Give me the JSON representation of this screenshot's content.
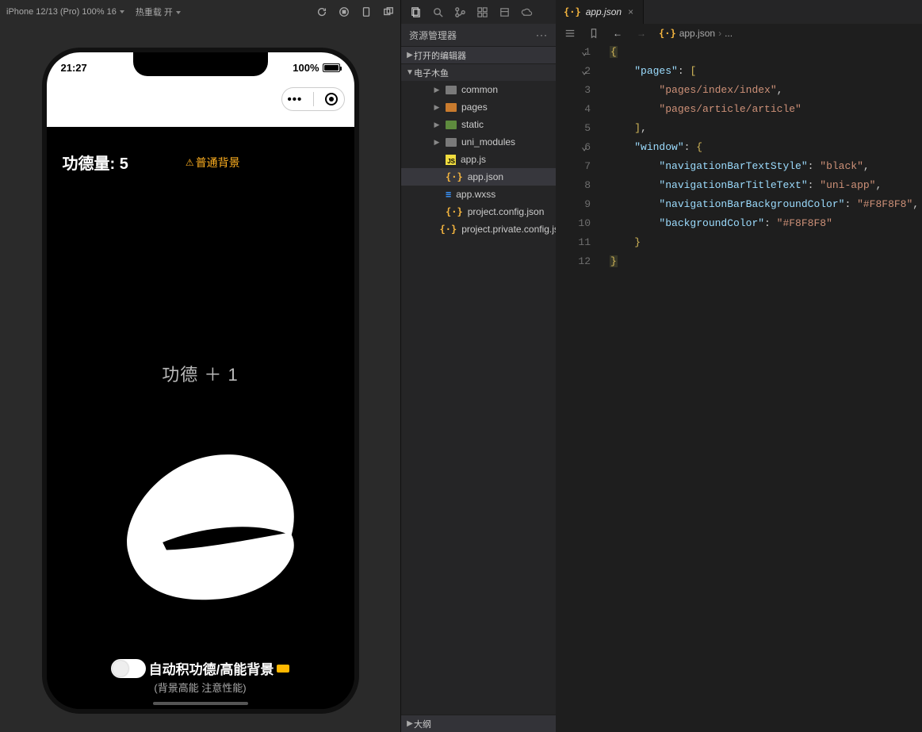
{
  "simulator": {
    "device_label": "iPhone 12/13 (Pro) 100% 16",
    "hot_reload_label": "热重载 开",
    "statusbar": {
      "time": "21:27",
      "battery_text": "100%"
    },
    "app": {
      "merit_label": "功德量: 5",
      "bg_mode_label": "普通背景",
      "float_text": "功德 ＋ 1",
      "auto_label": "自动积功德/高能背景",
      "auto_note": "(背景高能 注意性能)"
    }
  },
  "activity_icons": [
    "files-icon",
    "search-icon",
    "source-control-icon",
    "ext1-icon",
    "run-icon",
    "ext2-icon"
  ],
  "explorer": {
    "title": "资源管理器",
    "more_label": "···",
    "open_editors_label": "打开的编辑器",
    "project_label": "电子木鱼",
    "outline_label": "大纲",
    "tree": [
      {
        "type": "folder",
        "label": "common",
        "color": "gray"
      },
      {
        "type": "folder",
        "label": "pages",
        "color": "orange"
      },
      {
        "type": "folder",
        "label": "static",
        "color": "green"
      },
      {
        "type": "folder",
        "label": "uni_modules",
        "color": "gray"
      },
      {
        "type": "file",
        "label": "app.js",
        "icon": "js"
      },
      {
        "type": "file",
        "label": "app.json",
        "icon": "json",
        "selected": true
      },
      {
        "type": "file",
        "label": "app.wxss",
        "icon": "wxss"
      },
      {
        "type": "file",
        "label": "project.config.json",
        "icon": "json"
      },
      {
        "type": "file",
        "label": "project.private.config.js...",
        "icon": "json"
      }
    ]
  },
  "editor": {
    "tab_label": "app.json",
    "breadcrumb_file": "app.json",
    "breadcrumb_tail": "...",
    "code_lines": [
      {
        "n": 1,
        "ind": 0,
        "tokens": [
          {
            "t": "{",
            "c": "brace",
            "hl": true
          }
        ]
      },
      {
        "n": 2,
        "ind": 1,
        "tokens": [
          {
            "t": "\"pages\"",
            "c": "key"
          },
          {
            "t": ": ",
            "c": "punc"
          },
          {
            "t": "[",
            "c": "brace"
          }
        ]
      },
      {
        "n": 3,
        "ind": 2,
        "tokens": [
          {
            "t": "\"pages/index/index\"",
            "c": "str"
          },
          {
            "t": ",",
            "c": "punc"
          }
        ]
      },
      {
        "n": 4,
        "ind": 2,
        "tokens": [
          {
            "t": "\"pages/article/article\"",
            "c": "str"
          }
        ]
      },
      {
        "n": 5,
        "ind": 1,
        "tokens": [
          {
            "t": "]",
            "c": "brace"
          },
          {
            "t": ",",
            "c": "punc"
          }
        ]
      },
      {
        "n": 6,
        "ind": 1,
        "tokens": [
          {
            "t": "\"window\"",
            "c": "key"
          },
          {
            "t": ": ",
            "c": "punc"
          },
          {
            "t": "{",
            "c": "brace"
          }
        ]
      },
      {
        "n": 7,
        "ind": 2,
        "tokens": [
          {
            "t": "\"navigationBarTextStyle\"",
            "c": "key"
          },
          {
            "t": ": ",
            "c": "punc"
          },
          {
            "t": "\"black\"",
            "c": "str"
          },
          {
            "t": ",",
            "c": "punc"
          }
        ]
      },
      {
        "n": 8,
        "ind": 2,
        "tokens": [
          {
            "t": "\"navigationBarTitleText\"",
            "c": "key"
          },
          {
            "t": ": ",
            "c": "punc"
          },
          {
            "t": "\"uni-app\"",
            "c": "str"
          },
          {
            "t": ",",
            "c": "punc"
          }
        ]
      },
      {
        "n": 9,
        "ind": 2,
        "tokens": [
          {
            "t": "\"navigationBarBackgroundColor\"",
            "c": "key"
          },
          {
            "t": ": ",
            "c": "punc"
          },
          {
            "t": "\"#F8F8F8\"",
            "c": "hex"
          },
          {
            "t": ",",
            "c": "punc"
          }
        ]
      },
      {
        "n": 10,
        "ind": 2,
        "tokens": [
          {
            "t": "\"backgroundColor\"",
            "c": "key"
          },
          {
            "t": ": ",
            "c": "punc"
          },
          {
            "t": "\"#F8F8F8\"",
            "c": "hex"
          }
        ]
      },
      {
        "n": 11,
        "ind": 1,
        "tokens": [
          {
            "t": "}",
            "c": "brace"
          }
        ]
      },
      {
        "n": 12,
        "ind": 0,
        "tokens": [
          {
            "t": "}",
            "c": "brace",
            "hl": true
          }
        ]
      }
    ],
    "fold_markers": [
      {
        "line": 1
      },
      {
        "line": 2
      },
      {
        "line": 6
      }
    ]
  }
}
